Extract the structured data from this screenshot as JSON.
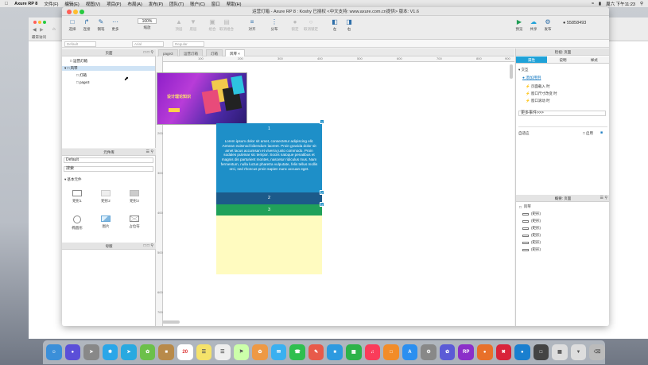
{
  "menubar": {
    "app": "Axure RP 8",
    "items": [
      "文件(F)",
      "编辑(E)",
      "视图(V)",
      "项目(P)",
      "布局(A)",
      "发布(P)",
      "团队(T)",
      "账户(C)",
      "窗口",
      "帮助(H)"
    ],
    "clock": "周六 下午11:23"
  },
  "browser": {
    "bookmark": "最常访问"
  },
  "window": {
    "title": "运营灯箱 - Axure RP 8 : Koshy 已授权 <中文支持: www.axure.com.cn提供> 版本: V1.6",
    "account": "55858493"
  },
  "toolbar": {
    "buttons": [
      "选择",
      "连接",
      "钢笔",
      "更多",
      "缩放",
      "顶层",
      "底层",
      "组合",
      "取消组合",
      "对齐",
      "分布",
      "锁定",
      "取消锁定",
      "左",
      "右",
      "预览",
      "共享",
      "发布"
    ],
    "zoom": "100%"
  },
  "formatbar": {
    "style": "Default",
    "font": "Arial",
    "weight": "Regular"
  },
  "pages_panel": {
    "title": "页面",
    "items": [
      "运营灯箱",
      "风琴",
      "灯箱",
      "page3"
    ]
  },
  "widgets_panel": {
    "title": "元件库",
    "library": "Default",
    "search_placeholder": "搜索",
    "section": "基本元件",
    "widgets": [
      "矩形1",
      "矩形2",
      "矩形3",
      "椭圆形",
      "图片",
      "占位符"
    ]
  },
  "masters_panel": {
    "title": "母版"
  },
  "canvas": {
    "tabs": [
      "page3",
      "运营灯箱",
      "灯箱",
      "风琴"
    ],
    "ruler_top": [
      "100",
      "200",
      "300",
      "400",
      "500",
      "600",
      "700",
      "800",
      "900"
    ],
    "ruler_left": [
      "100",
      "200",
      "300",
      "400",
      "500",
      "600",
      "700"
    ],
    "banner_text": "设计理论知识",
    "panel1_label": "1",
    "panel1_text": "Lorem ipsum dolor sit amet, consectetur adipiscing elit. Aenean euismod bibendum laoreet. Proin gravida dolor sit amet lacus accumsan et viverra justo commodo. Proin sodales pulvinar sic tempor. Sociis natoque penatibus et magnis dis parturient montes, nascetur ridiculus mus. Nam fermentum, nulla luctus pharetra vulputate, felis tellus mollis orci, sed rhoncus proin sapien nunc accuan eget.",
    "panel2_label": "2",
    "panel3_label": "3",
    "badges": [
      "1",
      "2",
      "3"
    ]
  },
  "inspector": {
    "title": "检视: 页面",
    "tabs": [
      "属性",
      "说明",
      "样式"
    ],
    "section": "交互",
    "add_case": "添加用例",
    "events": [
      "页面载入 时",
      "窗口尺寸改变 时",
      "窗口滚动 时"
    ],
    "more_events": "更多事件>>>",
    "adaptive_label": "自适应",
    "enable_label": "启用"
  },
  "outline": {
    "title": "概要: 页面",
    "root": "风琴",
    "items": [
      "(矩形)",
      "(矩形)",
      "(矩形)",
      "(矩形)",
      "(矩形)",
      "(矩形)"
    ]
  },
  "colors": {
    "panel1": "#1e8fc8",
    "panel2": "#1c5a8a",
    "panel3": "#20a15a",
    "yellow": "#fffbc0",
    "accent": "#1fa2d8"
  }
}
